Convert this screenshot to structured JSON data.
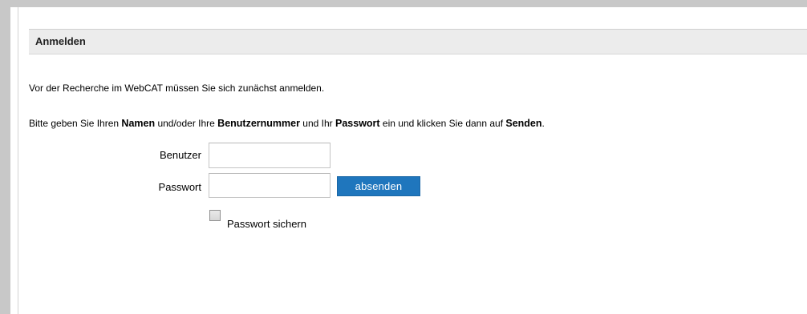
{
  "section": {
    "title": "Anmelden"
  },
  "intro": {
    "text": "Vor der Recherche im WebCAT müssen Sie sich zunächst anmelden."
  },
  "instruction": {
    "part1": "Bitte geben Sie Ihren ",
    "bold1": "Namen",
    "part2": " und/oder Ihre ",
    "bold2": "Benutzernummer",
    "part3": " und Ihr ",
    "bold3": "Passwort",
    "part4": " ein und klicken Sie dann auf ",
    "bold4": "Senden",
    "part5": "."
  },
  "form": {
    "user_label": "Benutzer",
    "user_value": "",
    "user_placeholder": "",
    "password_label": "Passwort",
    "password_value": "",
    "password_placeholder": "",
    "submit_label": "absenden",
    "remember_label": "Passwort sichern",
    "remember_checked": false
  },
  "colors": {
    "frame": "#c8c8c8",
    "header_background": "#ececec",
    "submit_background": "#1f76bd",
    "submit_text": "#ffffff"
  }
}
